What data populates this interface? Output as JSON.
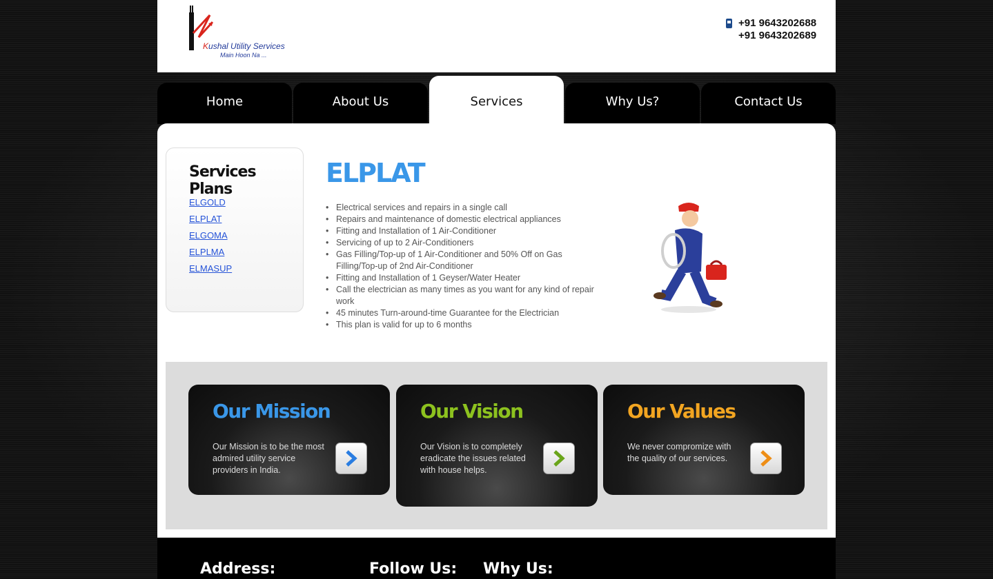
{
  "header": {
    "logo_name": "Kushal Utility Services",
    "logo_tagline": "Main Hoon Na ...",
    "phones": [
      "+91 9643202688",
      "+91 9643202689"
    ]
  },
  "nav": {
    "tabs": [
      {
        "label": "Home"
      },
      {
        "label": "About Us"
      },
      {
        "label": "Services",
        "active": true
      },
      {
        "label": "Why Us?"
      },
      {
        "label": "Contact Us"
      }
    ]
  },
  "sidebar": {
    "title": "Services Plans",
    "plans": [
      "ELGOLD",
      "ELPLAT",
      "ELGOMA",
      "ELPLMA",
      "ELMASUP"
    ]
  },
  "plan": {
    "title": "ELPLAT",
    "features": [
      "Electrical services and repairs in a single call",
      "Repairs and maintenance of domestic electrical appliances",
      "Fitting and Installation of 1 Air-Conditioner",
      "Servicing of up to 2 Air-Conditioners",
      "Gas Filling/Top-up of 1 Air-Conditioner and 50% Off on Gas Filling/Top-up of 2nd Air-Conditioner",
      "Fitting and Installation of 1 Geyser/Water Heater",
      "Call the electrician as many times as you want for any kind of repair work",
      "45 minutes Turn-around-time Guarantee for the Electrician",
      "This plan is valid for up to 6 months"
    ]
  },
  "info_boxes": [
    {
      "title": "Our Mission",
      "text": "Our Mission is to be the most admired utility service providers in India.",
      "color": "#3a97e8"
    },
    {
      "title": "Our Vision",
      "text": "Our Vision is to completely eradicate the issues related with house helps.",
      "color": "#8dc21f"
    },
    {
      "title": "Our Values",
      "text": "We never compromize with the quality of our services.",
      "color": "#f2a521"
    }
  ],
  "footer": {
    "address_heading": "Address:",
    "follow_heading": "Follow Us:",
    "why_heading": "Why Us:"
  }
}
